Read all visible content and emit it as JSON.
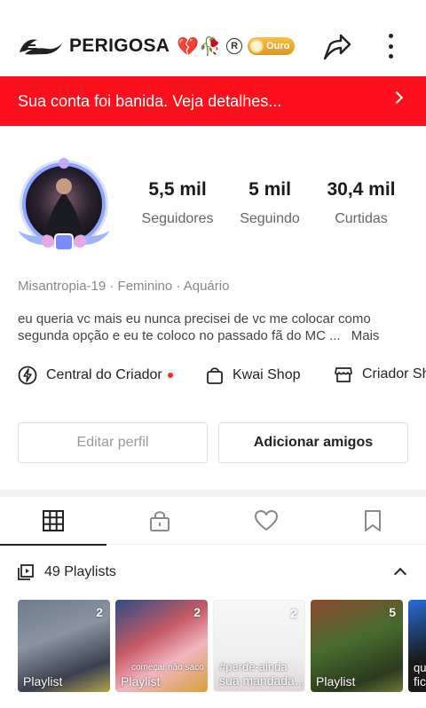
{
  "header": {
    "username": "PERIGOSA",
    "emoji": "💔🥀",
    "registered_mark": "R",
    "badge_label": "Ouro",
    "colors": {
      "badge": "#f0a72a"
    }
  },
  "ban_banner": {
    "message": "Sua conta foi banida. Veja detalhes...",
    "color": "#fe0f1e"
  },
  "stats": [
    {
      "value": "5,5 mil",
      "label": "Seguidores"
    },
    {
      "value": "5 mil",
      "label": "Seguindo"
    },
    {
      "value": "30,4 mil",
      "label": "Curtidas"
    }
  ],
  "meta": "Misantropia-19 · Feminino · Aquário",
  "bio": {
    "text": "eu queria vc mais eu nunca precisei de vc  me colocar como segunda opção e eu te coloco no passado fã do MC ...",
    "more": "Mais"
  },
  "links": [
    {
      "label": "Central do Criador",
      "icon": "lightning-icon"
    },
    {
      "label": "Kwai Shop",
      "icon": "shopping-bag-icon"
    },
    {
      "label": "Criador Sh",
      "icon": "store-icon"
    }
  ],
  "buttons": {
    "edit": "Editar perfil",
    "add": "Adicionar amigos"
  },
  "tabs": [
    {
      "name": "grid",
      "icon": "grid-icon",
      "active": true
    },
    {
      "name": "private",
      "icon": "lock-icon",
      "active": false
    },
    {
      "name": "likes",
      "icon": "heart-icon",
      "active": false
    },
    {
      "name": "saved",
      "icon": "bookmark-icon",
      "active": false
    }
  ],
  "playlists": {
    "count_label": "49 Playlists",
    "items": [
      {
        "count": "2",
        "label": "Playlist"
      },
      {
        "count": "2",
        "label": "Playlist",
        "overlay": "começar não saco"
      },
      {
        "count": "2",
        "label": "sua mandada...",
        "overlay": "#perde-ainda"
      },
      {
        "count": "5",
        "label": "Playlist"
      },
      {
        "count": "",
        "label": "fic",
        "overlay": "qu"
      }
    ]
  }
}
